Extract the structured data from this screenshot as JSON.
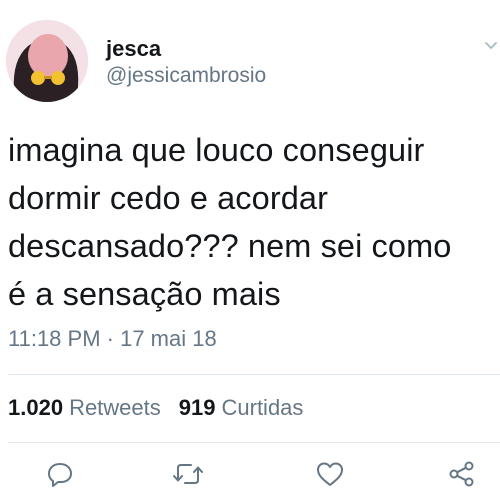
{
  "tweet": {
    "display_name": "jesca",
    "handle": "@jessicambrosio",
    "text": "imagina que louco conseguir\ndormir cedo e acordar\ndescansado??? nem sei como\né a sensação mais",
    "timestamp": "11:18 PM · 17 mai 18",
    "retweets_count": "1.020",
    "retweets_label": "Retweets",
    "likes_count": "919",
    "likes_label": "Curtidas"
  },
  "icons": {
    "avatar": "profile-photo",
    "menu": "chevron-down-icon",
    "reply": "reply-icon",
    "retweet": "retweet-icon",
    "like": "heart-icon",
    "share": "share-icon"
  },
  "colors": {
    "secondary_text": "#657786",
    "primary_text": "#14171a",
    "divider": "#e1e8ed"
  }
}
